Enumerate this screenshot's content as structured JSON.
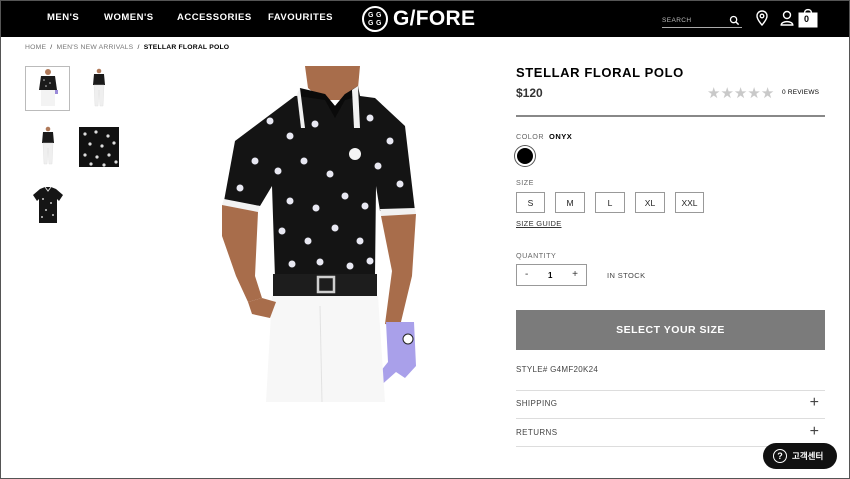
{
  "nav": {
    "items": [
      "MEN'S",
      "WOMEN'S",
      "ACCESSORIES",
      "FAVOURITES"
    ],
    "logo_text": "G/FORE",
    "search_placeholder": "SEARCH",
    "cart_count": "0"
  },
  "breadcrumb": {
    "home": "HOME",
    "category": "MEN'S NEW ARRIVALS",
    "current": "STELLAR FLORAL POLO",
    "separator": "/"
  },
  "product": {
    "title": "STELLAR FLORAL POLO",
    "price": "$120",
    "rating_stars": 0,
    "reviews_label": "0 REVIEWS",
    "color_label": "COLOR",
    "color_value": "ONYX",
    "swatch_color": "#000000",
    "size_label": "SIZE",
    "sizes": [
      "S",
      "M",
      "L",
      "XL",
      "XXL"
    ],
    "size_guide": "SIZE GUIDE",
    "quantity_label": "QUANTITY",
    "quantity_minus": "-",
    "quantity_value": "1",
    "quantity_plus": "+",
    "stock_status": "IN STOCK",
    "cta_label": "SELECT YOUR SIZE",
    "cta_color": "#7b7b7b",
    "style_number": "STYLE# G4MF20K24",
    "accordions": [
      {
        "label": "SHIPPING",
        "icon": "plus-icon"
      },
      {
        "label": "RETURNS",
        "icon": "plus-icon"
      }
    ]
  },
  "chat": {
    "label": "고객센터",
    "icon": "question-icon"
  }
}
